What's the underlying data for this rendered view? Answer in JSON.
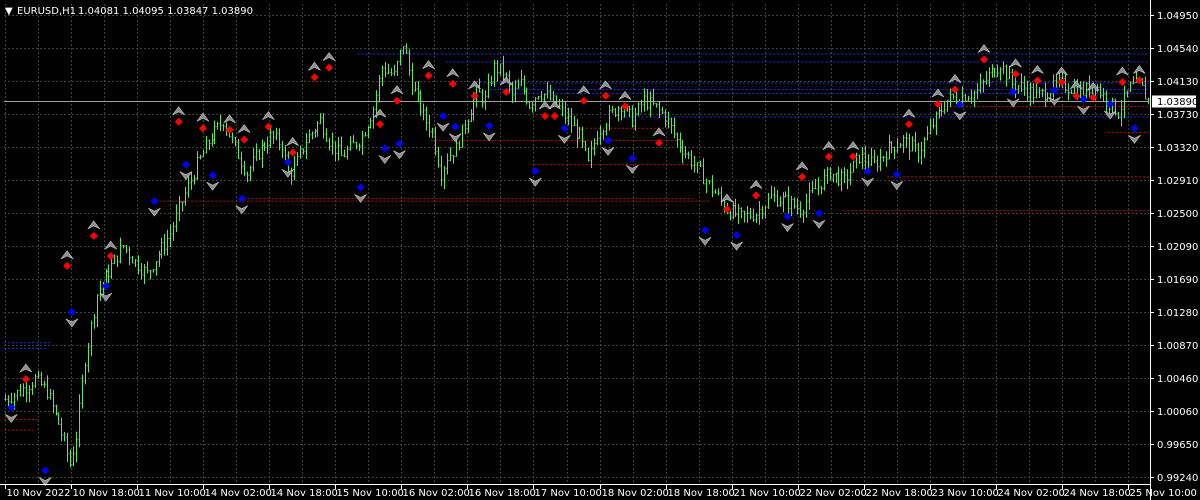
{
  "header": {
    "menu_arrow": "▼",
    "symbol": "EURUSD,H1",
    "ohlc": "1.04081 1.04095 1.03847 1.03890"
  },
  "colors": {
    "background": "#000000",
    "grid": "#404040",
    "candles": "#5ee65e",
    "sell_marker": "#ff0000",
    "buy_marker": "#0000ff",
    "arrow_marker": "#8c8c8c",
    "resistance_line": "#1d2ddd",
    "support_line": "#b01010",
    "bid_line": "#a0a0a0",
    "text": "#ffffff"
  },
  "chart_data": {
    "type": "candlestick",
    "symbol": "EURUSD",
    "timeframe": "H1",
    "ylim": [
      0.9924,
      1.0495
    ],
    "y_ticks": [
      "1.04950",
      "1.04540",
      "1.04130",
      "1.03730",
      "1.03320",
      "1.02910",
      "1.02500",
      "1.02090",
      "1.01690",
      "1.01280",
      "1.00870",
      "1.00460",
      "1.00060",
      "0.99650",
      "0.99240"
    ],
    "x_ticks": [
      "10 Nov 2022",
      "10 Nov 18:00",
      "11 Nov 10:00",
      "14 Nov 02:00",
      "14 Nov 18:00",
      "15 Nov 10:00",
      "16 Nov 02:00",
      "16 Nov 18:00",
      "17 Nov 10:00",
      "18 Nov 02:00",
      "18 Nov 18:00",
      "21 Nov 10:00",
      "22 Nov 02:00",
      "22 Nov 18:00",
      "23 Nov 10:00",
      "24 Nov 02:00",
      "24 Nov 18:00",
      "25 Nov 10:00"
    ],
    "current_price": "1.03890",
    "close_path": [
      [
        0,
        1.002
      ],
      [
        5,
        1.003
      ],
      [
        10,
        1.0045
      ],
      [
        14,
        1.003
      ],
      [
        18,
        0.999
      ],
      [
        22,
        0.994
      ],
      [
        24,
        0.9975
      ],
      [
        27,
        1.007
      ],
      [
        31,
        1.015
      ],
      [
        36,
        1.0185
      ],
      [
        40,
        1.021
      ],
      [
        44,
        1.019
      ],
      [
        48,
        1.0175
      ],
      [
        52,
        1.02
      ],
      [
        56,
        1.0225
      ],
      [
        60,
        1.0265
      ],
      [
        65,
        1.031
      ],
      [
        70,
        1.0345
      ],
      [
        74,
        1.0365
      ],
      [
        78,
        1.033
      ],
      [
        82,
        1.03
      ],
      [
        86,
        1.0325
      ],
      [
        90,
        1.0345
      ],
      [
        94,
        1.0335
      ],
      [
        96,
        1.03
      ],
      [
        98,
        1.0305
      ],
      [
        102,
        1.034
      ],
      [
        107,
        1.0365
      ],
      [
        110,
        1.034
      ],
      [
        114,
        1.032
      ],
      [
        117,
        1.033
      ],
      [
        121,
        1.0345
      ],
      [
        125,
        1.038
      ],
      [
        128,
        1.043
      ],
      [
        132,
        1.042
      ],
      [
        135,
        1.046
      ],
      [
        138,
        1.041
      ],
      [
        142,
        1.037
      ],
      [
        145,
        1.035
      ],
      [
        148,
        1.03
      ],
      [
        150,
        1.032
      ],
      [
        153,
        1.033
      ],
      [
        157,
        1.037
      ],
      [
        160,
        1.04
      ],
      [
        163,
        1.039
      ],
      [
        166,
        1.043
      ],
      [
        169,
        1.0425
      ],
      [
        172,
        1.0395
      ],
      [
        175,
        1.041
      ],
      [
        178,
        1.0385
      ],
      [
        181,
        1.04
      ],
      [
        184,
        1.0395
      ],
      [
        188,
        1.038
      ],
      [
        192,
        1.036
      ],
      [
        195,
        1.0345
      ],
      [
        198,
        1.031
      ],
      [
        201,
        1.035
      ],
      [
        205,
        1.037
      ],
      [
        209,
        1.0385
      ],
      [
        213,
        1.0365
      ],
      [
        217,
        1.039
      ],
      [
        221,
        1.038
      ],
      [
        224,
        1.037
      ],
      [
        228,
        1.034
      ],
      [
        232,
        1.032
      ],
      [
        236,
        1.03
      ],
      [
        240,
        1.028
      ],
      [
        245,
        1.0255
      ],
      [
        250,
        1.0245
      ],
      [
        255,
        1.025
      ],
      [
        260,
        1.027
      ],
      [
        265,
        1.0265
      ],
      [
        270,
        1.0255
      ],
      [
        275,
        1.028
      ],
      [
        280,
        1.03
      ],
      [
        285,
        1.029
      ],
      [
        290,
        1.032
      ],
      [
        295,
        1.031
      ],
      [
        300,
        1.033
      ],
      [
        305,
        1.034
      ],
      [
        310,
        1.0325
      ],
      [
        315,
        1.036
      ],
      [
        320,
        1.039
      ],
      [
        325,
        1.0395
      ],
      [
        330,
        1.04
      ],
      [
        334,
        1.042
      ],
      [
        338,
        1.0435
      ],
      [
        342,
        1.041
      ],
      [
        346,
        1.0405
      ],
      [
        350,
        1.0395
      ],
      [
        354,
        1.04
      ],
      [
        358,
        1.041
      ],
      [
        362,
        1.0405
      ],
      [
        366,
        1.04
      ],
      [
        370,
        1.041
      ],
      [
        374,
        1.039
      ],
      [
        378,
        1.0375
      ],
      [
        382,
        1.0405
      ],
      [
        385,
        1.041
      ],
      [
        388,
        1.0389
      ]
    ],
    "bars": 389,
    "resistance_levels": [
      {
        "price": 1.0447,
        "from_bar": 120,
        "to_bar": 389
      },
      {
        "price": 1.0437,
        "from_bar": 150,
        "to_bar": 389
      },
      {
        "price": 1.0411,
        "from_bar": 160,
        "to_bar": 389
      },
      {
        "price": 1.0403,
        "from_bar": 165,
        "to_bar": 389
      },
      {
        "price": 1.0398,
        "from_bar": 170,
        "to_bar": 389
      },
      {
        "price": 1.0369,
        "from_bar": 210,
        "to_bar": 389
      },
      {
        "price": 1.009,
        "from_bar": 0,
        "to_bar": 16
      },
      {
        "price": 1.0083,
        "from_bar": 0,
        "to_bar": 14
      }
    ],
    "support_levels": [
      {
        "price": 1.0265,
        "from_bar": 50,
        "to_bar": 240
      },
      {
        "price": 1.0268,
        "from_bar": 80,
        "to_bar": 235
      },
      {
        "price": 1.034,
        "from_bar": 145,
        "to_bar": 230
      },
      {
        "price": 1.0355,
        "from_bar": 195,
        "to_bar": 225
      },
      {
        "price": 1.031,
        "from_bar": 180,
        "to_bar": 235
      },
      {
        "price": 1.0253,
        "from_bar": 285,
        "to_bar": 389
      },
      {
        "price": 1.0295,
        "from_bar": 300,
        "to_bar": 389
      },
      {
        "price": 1.0382,
        "from_bar": 320,
        "to_bar": 389
      },
      {
        "price": 1.035,
        "from_bar": 375,
        "to_bar": 389
      },
      {
        "price": 0.9995,
        "from_bar": 0,
        "to_bar": 12
      },
      {
        "price": 0.9982,
        "from_bar": 0,
        "to_bar": 10
      }
    ],
    "sell_signals": [
      {
        "bar": 9,
        "price": 1.0045
      },
      {
        "bar": 26,
        "price": 1.0185
      },
      {
        "bar": 37,
        "price": 1.0222
      },
      {
        "bar": 44,
        "price": 1.0197
      },
      {
        "bar": 72,
        "price": 1.0363
      },
      {
        "bar": 82,
        "price": 1.0355
      },
      {
        "bar": 93,
        "price": 1.0353
      },
      {
        "bar": 99,
        "price": 1.0341
      },
      {
        "bar": 109,
        "price": 1.0357
      },
      {
        "bar": 119,
        "price": 1.0325
      },
      {
        "bar": 128,
        "price": 1.0418
      },
      {
        "bar": 134,
        "price": 1.043
      },
      {
        "bar": 155,
        "price": 1.036
      },
      {
        "bar": 162,
        "price": 1.0389
      },
      {
        "bar": 175,
        "price": 1.042
      },
      {
        "bar": 185,
        "price": 1.041
      },
      {
        "bar": 194,
        "price": 1.0395
      },
      {
        "bar": 207,
        "price": 1.04
      },
      {
        "bar": 223,
        "price": 1.037
      },
      {
        "bar": 227,
        "price": 1.037
      },
      {
        "bar": 239,
        "price": 1.0389
      },
      {
        "bar": 248,
        "price": 1.0395
      },
      {
        "bar": 256,
        "price": 1.0382
      },
      {
        "bar": 270,
        "price": 1.0337
      },
      {
        "bar": 298,
        "price": 1.0255
      },
      {
        "bar": 310,
        "price": 1.0272
      },
      {
        "bar": 329,
        "price": 1.0295
      },
      {
        "bar": 340,
        "price": 1.032
      },
      {
        "bar": 350,
        "price": 1.032
      },
      {
        "bar": 373,
        "price": 1.036
      },
      {
        "bar": 385,
        "price": 1.0385
      },
      {
        "bar": 392,
        "price": 1.0403
      },
      {
        "bar": 404,
        "price": 1.044
      },
      {
        "bar": 417,
        "price": 1.0422
      },
      {
        "bar": 426,
        "price": 1.0414
      },
      {
        "bar": 436,
        "price": 1.0412
      },
      {
        "bar": 442,
        "price": 1.0395
      },
      {
        "bar": 449,
        "price": 1.0393
      },
      {
        "bar": 461,
        "price": 1.0412
      },
      {
        "bar": 468,
        "price": 1.0414
      }
    ],
    "buy_signals": [
      {
        "bar": 3,
        "price": 1.001
      },
      {
        "bar": 17,
        "price": 0.9932
      },
      {
        "bar": 28,
        "price": 1.0128
      },
      {
        "bar": 42,
        "price": 1.016
      },
      {
        "bar": 62,
        "price": 1.0265
      },
      {
        "bar": 75,
        "price": 1.031
      },
      {
        "bar": 86,
        "price": 1.0297
      },
      {
        "bar": 98,
        "price": 1.0268
      },
      {
        "bar": 117,
        "price": 1.0313
      },
      {
        "bar": 147,
        "price": 1.0282
      },
      {
        "bar": 157,
        "price": 1.033
      },
      {
        "bar": 163,
        "price": 1.0336
      },
      {
        "bar": 181,
        "price": 1.037
      },
      {
        "bar": 186,
        "price": 1.0357
      },
      {
        "bar": 200,
        "price": 1.0358
      },
      {
        "bar": 219,
        "price": 1.0302
      },
      {
        "bar": 231,
        "price": 1.0355
      },
      {
        "bar": 249,
        "price": 1.034
      },
      {
        "bar": 259,
        "price": 1.0318
      },
      {
        "bar": 289,
        "price": 1.0229
      },
      {
        "bar": 302,
        "price": 1.0223
      },
      {
        "bar": 323,
        "price": 1.0246
      },
      {
        "bar": 336,
        "price": 1.025
      },
      {
        "bar": 356,
        "price": 1.0302
      },
      {
        "bar": 368,
        "price": 1.0298
      },
      {
        "bar": 394,
        "price": 1.0384
      },
      {
        "bar": 416,
        "price": 1.04
      },
      {
        "bar": 433,
        "price": 1.0402
      },
      {
        "bar": 445,
        "price": 1.0391
      },
      {
        "bar": 456,
        "price": 1.0385
      },
      {
        "bar": 466,
        "price": 1.0355
      }
    ]
  }
}
